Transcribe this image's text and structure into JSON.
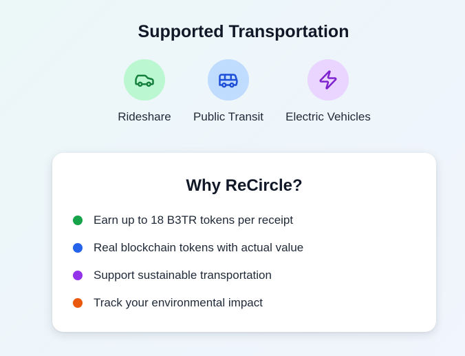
{
  "transportation": {
    "title": "Supported Transportation",
    "options": [
      {
        "label": "Rideshare",
        "icon": "car-icon",
        "bg_color": "#bbf7d0",
        "icon_color": "#15803d"
      },
      {
        "label": "Public Transit",
        "icon": "bus-icon",
        "bg_color": "#bfdbfe",
        "icon_color": "#1d4ed8"
      },
      {
        "label": "Electric Vehicles",
        "icon": "lightning-bolt-icon",
        "bg_color": "#e9d5ff",
        "icon_color": "#7e22ce"
      }
    ]
  },
  "why_card": {
    "title": "Why ReCircle?",
    "items": [
      {
        "text": "Earn up to 18 B3TR tokens per receipt",
        "dot_color": "#16a34a"
      },
      {
        "text": "Real blockchain tokens with actual value",
        "dot_color": "#2563eb"
      },
      {
        "text": "Support sustainable transportation",
        "dot_color": "#9333ea"
      },
      {
        "text": "Track your environmental impact",
        "dot_color": "#ea580c"
      }
    ]
  }
}
